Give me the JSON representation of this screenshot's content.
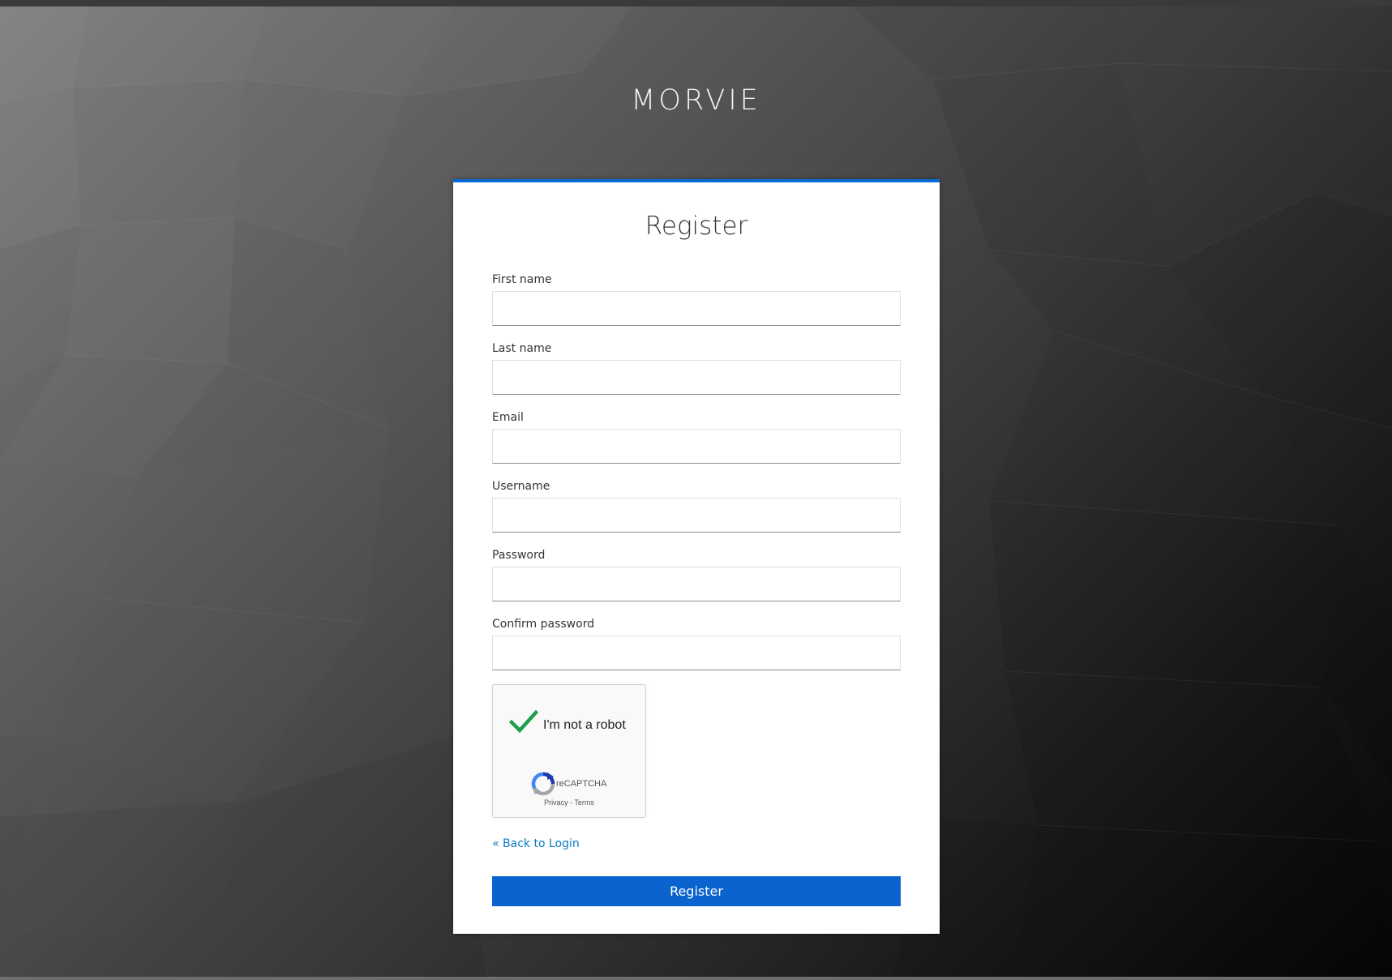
{
  "brand": {
    "name": "MORVIE"
  },
  "form": {
    "title": "Register",
    "fields": [
      {
        "label": "First name",
        "value": ""
      },
      {
        "label": "Last name",
        "value": ""
      },
      {
        "label": "Email",
        "value": ""
      },
      {
        "label": "Username",
        "value": ""
      },
      {
        "label": "Password",
        "value": ""
      },
      {
        "label": "Confirm password",
        "value": ""
      }
    ],
    "recaptcha": {
      "label": "I'm not a robot",
      "checked": true,
      "brand": "reCAPTCHA",
      "privacy": "Privacy",
      "separator": " - ",
      "terms": "Terms",
      "check_color": "#1e9e4a",
      "icon": "recaptcha-logo-icon"
    },
    "back_link": "« Back to Login",
    "submit_label": "Register"
  },
  "colors": {
    "accent": "#0a63cf",
    "link": "#0a79c7"
  }
}
